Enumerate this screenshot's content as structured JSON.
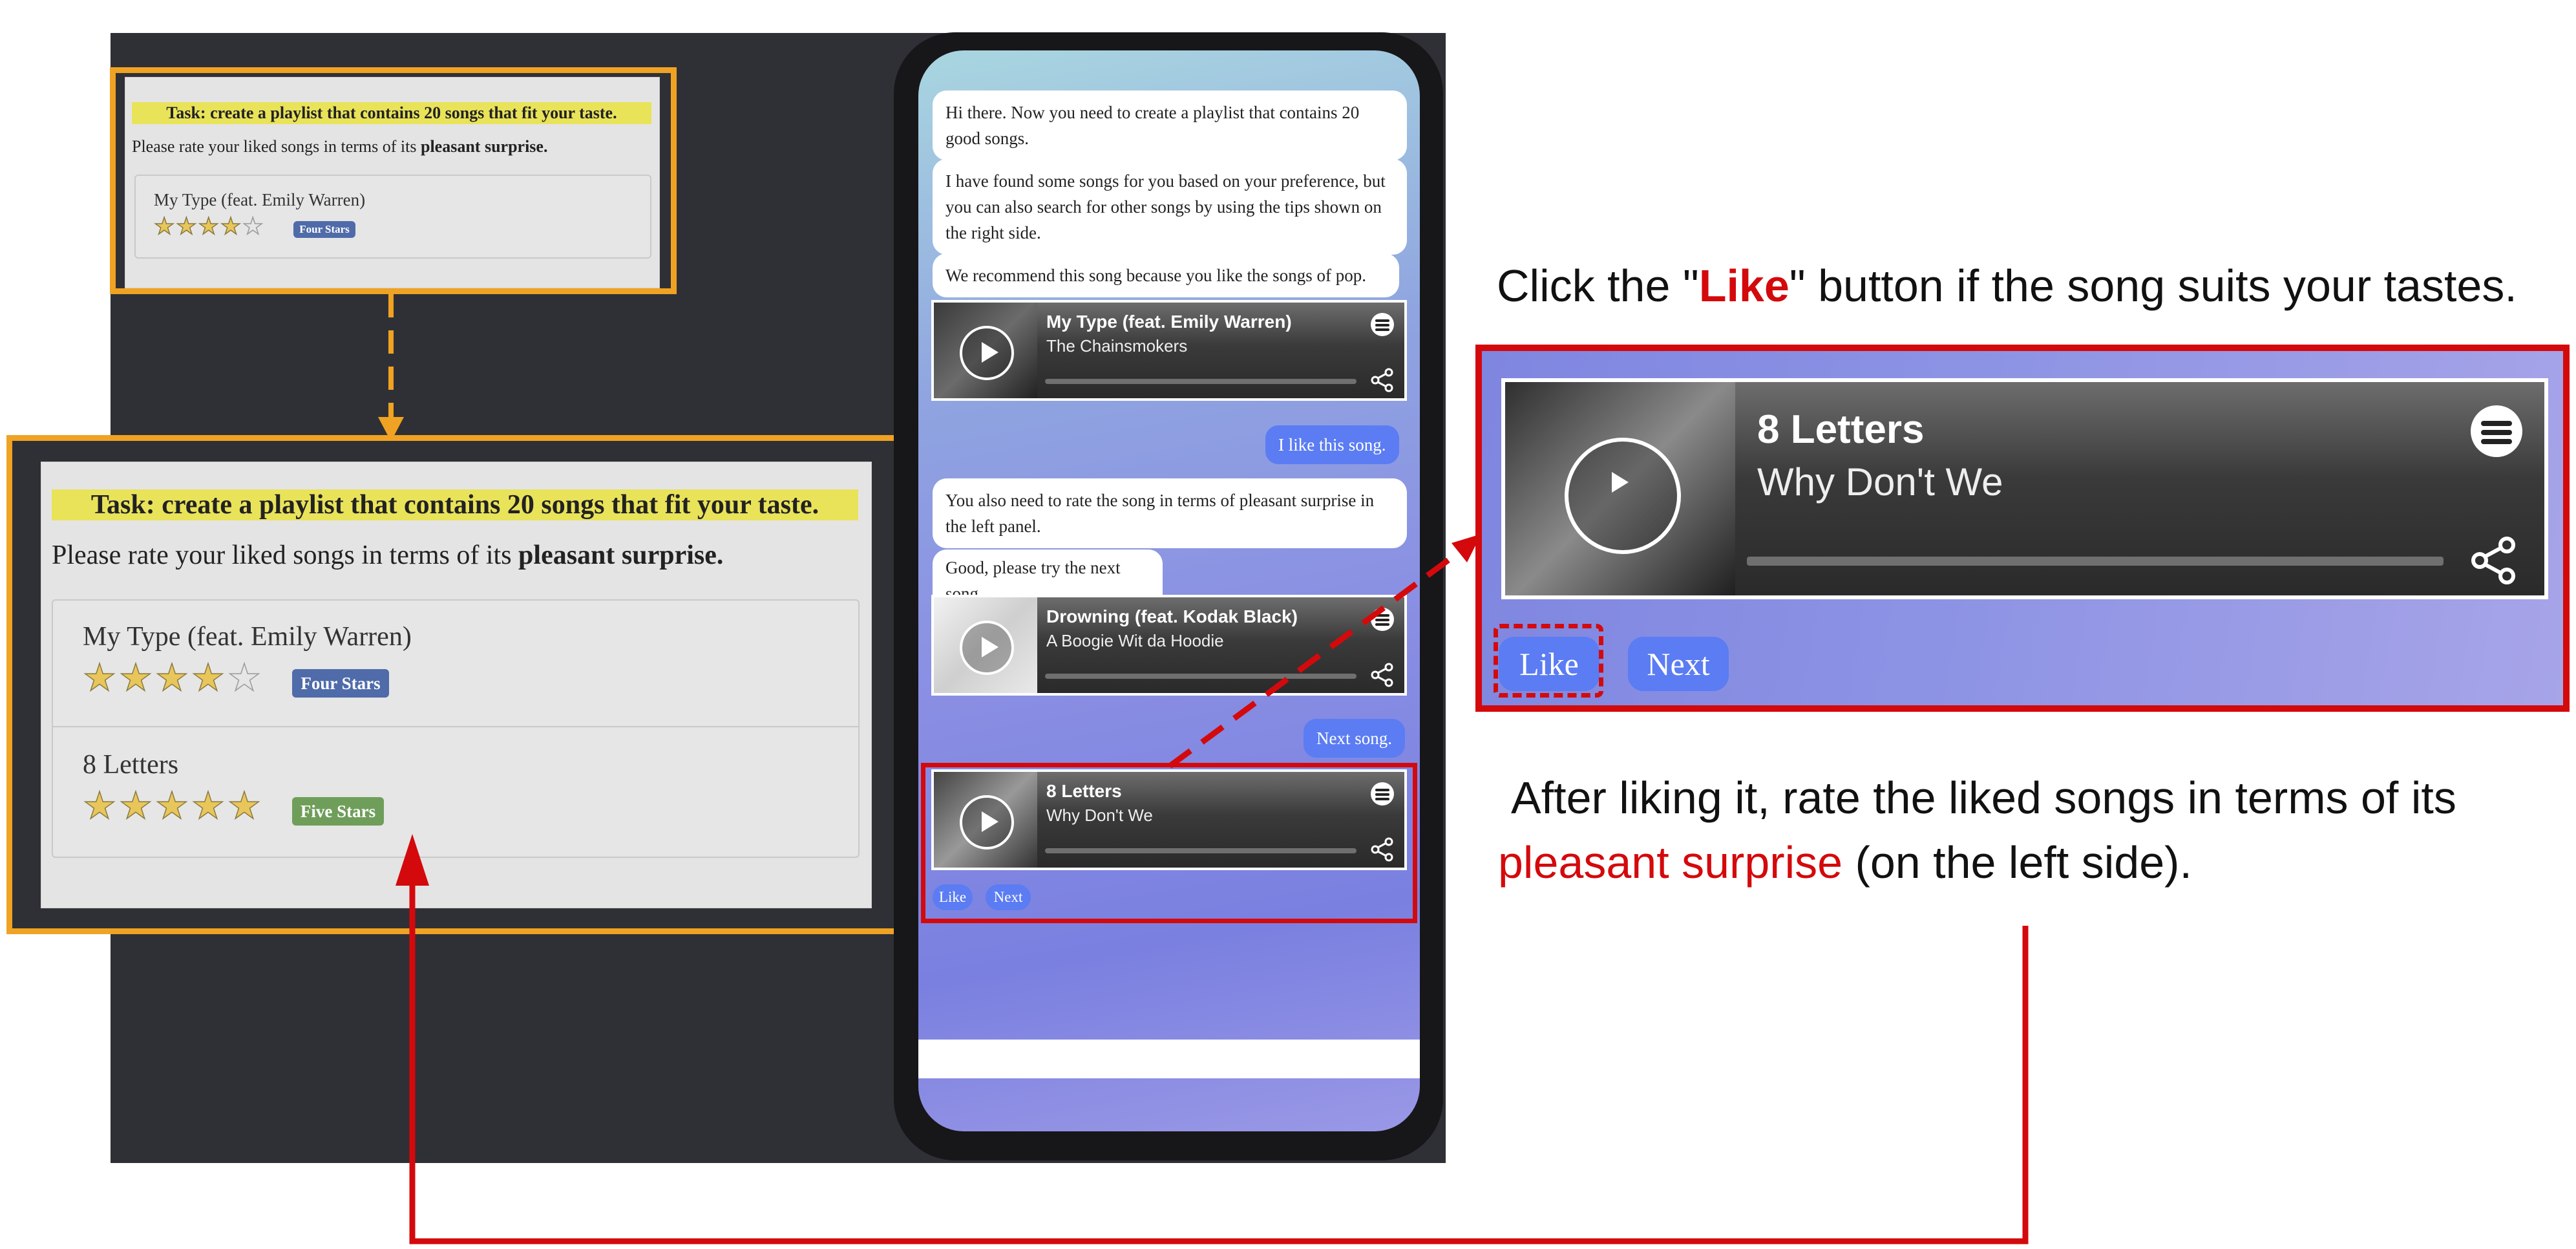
{
  "task_panel": {
    "task_text": "Task: create a playlist that contains 20 songs that fit your taste.",
    "instruction_prefix": "Please rate your liked songs in terms of its ",
    "instruction_bold": "pleasant surprise."
  },
  "rated_songs": [
    {
      "title": "My Type (feat. Emily Warren)",
      "stars": 4,
      "badge": "Four Stars",
      "badge_color": "#4f6ba9"
    },
    {
      "title": "8 Letters",
      "stars": 5,
      "badge": "Five Stars",
      "badge_color": "#6f9e5a"
    }
  ],
  "chat": {
    "msg1": "Hi there. Now you need to create a playlist that contains 20 good songs.",
    "msg2": "I have found some songs for you based on your preference, but you can also search for other songs by using the tips shown on the right side.",
    "msg3": "We recommend this song because you like the songs of pop.",
    "user1": "I like this song.",
    "msg4": "You also need to rate the song in terms of pleasant surprise in the left panel.",
    "msg5": "Good, please try the next song.",
    "user2": "Next song."
  },
  "tracks": [
    {
      "title": "My Type (feat. Emily Warren)",
      "artist": "The Chainsmokers"
    },
    {
      "title": "Drowning (feat. Kodak Black)",
      "artist": "A Boogie Wit da Hoodie"
    },
    {
      "title": "8 Letters",
      "artist": "Why Don't We"
    }
  ],
  "buttons": {
    "like": "Like",
    "next": "Next"
  },
  "annotations": {
    "click_pre": "Click the \"",
    "click_like": "Like",
    "click_post": "\" button if the song suits your tastes.",
    "after_line1": "After liking it, rate the liked songs in terms of its",
    "after_red": "pleasant surprise",
    "after_post": " (on the left side)."
  },
  "colors": {
    "accent_orange": "#f0a223",
    "accent_red": "#d4090c",
    "bubble_blue": "#5b7cf2"
  }
}
